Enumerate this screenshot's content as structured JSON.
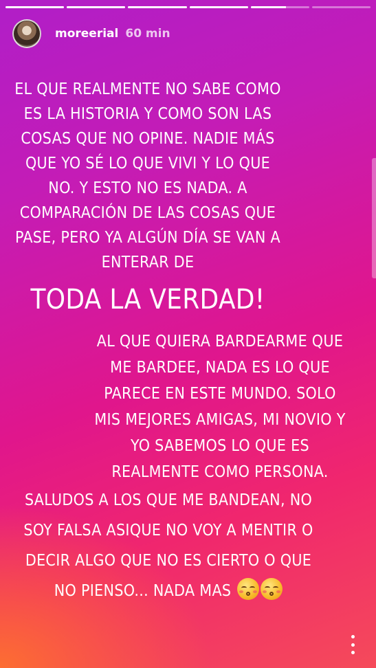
{
  "progress": {
    "segments": [
      1,
      1,
      1,
      1,
      0.6,
      0
    ]
  },
  "header": {
    "username": "moreerial",
    "time": "60 min"
  },
  "story": {
    "block1": "EL QUE REALMENTE NO SABE COMO ES LA HISTORIA Y COMO SON LAS COSAS QUE NO OPINE. NADIE MÁS QUE YO SÉ LO QUE VIVI Y LO QUE NO. Y ESTO NO ES NADA. A COMPARACIÓN DE LAS COSAS QUE PASE, PERO YA ALGÚN DÍA SE VAN A ENTERAR DE",
    "block1_big": "TODA LA VERDAD!",
    "block2": "AL QUE QUIERA BARDEARME QUE ME BARDEE, NADA ES LO QUE PARECE EN ESTE MUNDO. SOLO MIS MEJORES AMIGAS, MI NOVIO Y YO SABEMOS LO QUE ES REALMENTE COMO PERSONA.",
    "block3": "SALUDOS A LOS QUE ME BANDEAN, NO SOY FALSA ASIQUE NO VOY A MENTIR O DECIR ALGO QUE NO ES CIERTO O QUE NO PIENSO... NADA MAS"
  },
  "icons": {
    "emoji": "kissing-face-closed-eyes",
    "menu": "more-vertical-icon"
  }
}
